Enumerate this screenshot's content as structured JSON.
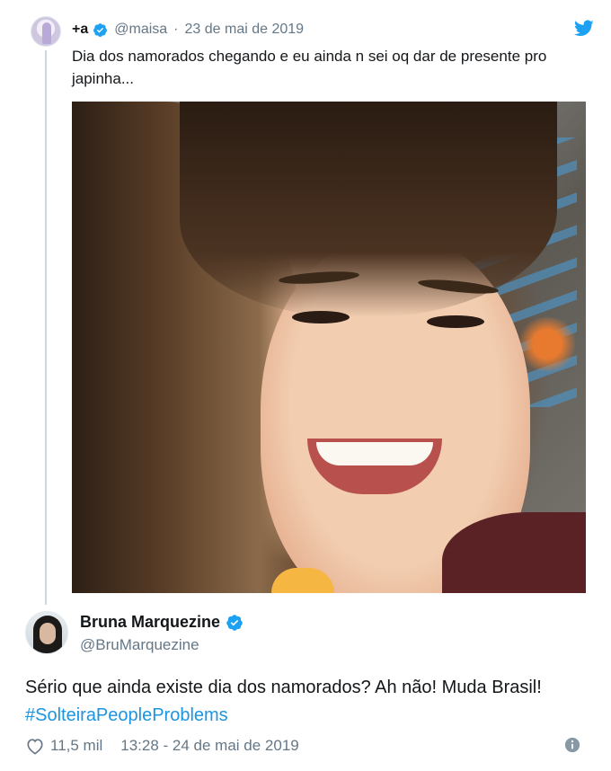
{
  "quoted_tweet": {
    "display_name": "+a",
    "handle": "@maisa",
    "separator": "·",
    "date": "23 de mai de 2019",
    "text": "Dia dos namorados chegando e eu ainda n sei oq dar de presente pro japinha...",
    "verified": true,
    "media_icon": "photo-of-smiling-woman"
  },
  "reply_tweet": {
    "display_name": "Bruna Marquezine",
    "handle": "@BruMarquezine",
    "verified": true,
    "text_main": "Sério que ainda existe dia dos namorados? Ah não! Muda Brasil!",
    "hashtag": "#SolteiraPeopleProblems",
    "likes": "11,5 mil",
    "timestamp": "13:28 - 24 de mai de 2019"
  },
  "icons": {
    "brand": "twitter-bird-icon",
    "like": "heart-icon",
    "info": "info-icon",
    "verified": "verified-badge-icon"
  },
  "colors": {
    "twitter_blue": "#1da1f2",
    "hashtag": "#1b95e0",
    "secondary_text": "#657786",
    "primary_text": "#14171a",
    "thread_line": "#ccd6dd"
  }
}
